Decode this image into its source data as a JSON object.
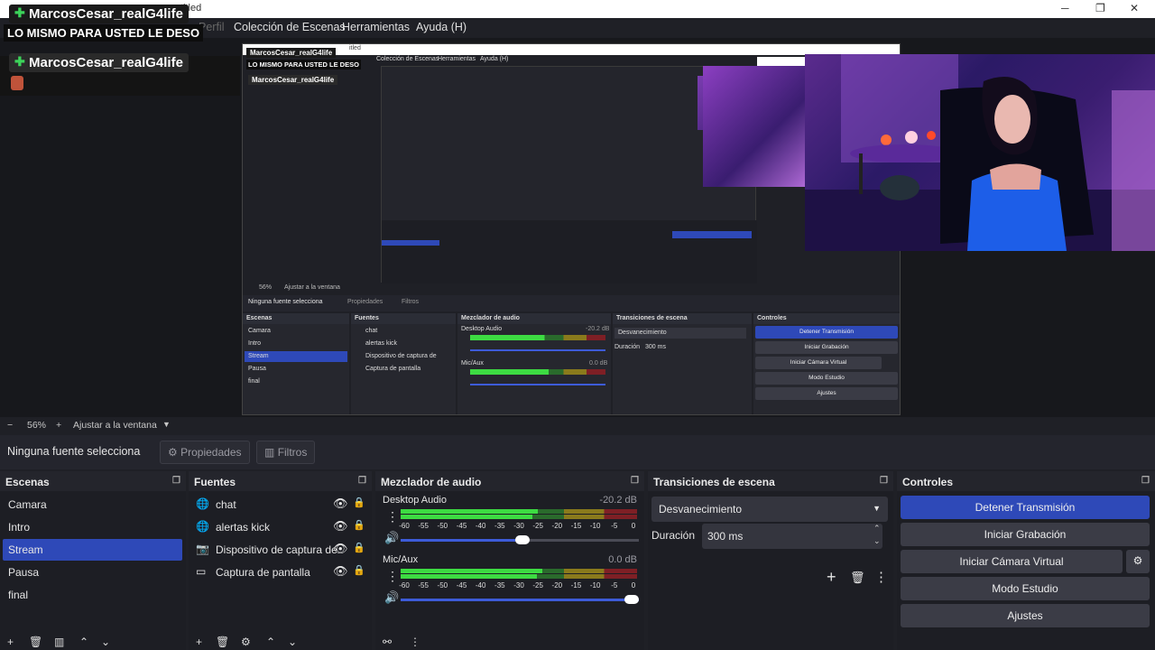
{
  "window": {
    "title_fragment": "titled",
    "min": "─",
    "max": "❐",
    "close": "✕"
  },
  "overlay": {
    "user_top": "MarcosCesar_realG4life",
    "banner": "LO MISMO PARA USTED LE DESO",
    "user_chat": "MarcosCesar_realG4life"
  },
  "menu": {
    "perfil": "Perfil",
    "colecciones": "Colección de Escenas",
    "herramientas": "Herramientas",
    "ayuda": "Ayuda (H)"
  },
  "zoom": {
    "minus": "−",
    "level": "56%",
    "plus": "+",
    "fit": "Ajustar a la ventana"
  },
  "source_bar": {
    "no_selection": "Ninguna fuente selecciona",
    "properties": "Propiedades",
    "filters": "Filtros"
  },
  "scenes": {
    "title": "Escenas",
    "items": [
      {
        "label": "Camara"
      },
      {
        "label": "Intro"
      },
      {
        "label": "Stream"
      },
      {
        "label": "Pausa"
      },
      {
        "label": "final"
      }
    ],
    "selected": 2
  },
  "sources": {
    "title": "Fuentes",
    "items": [
      {
        "label": "chat",
        "icon": "globe-icon"
      },
      {
        "label": "alertas kick",
        "icon": "globe-icon"
      },
      {
        "label": "Dispositivo de captura de",
        "icon": "camera-icon"
      },
      {
        "label": "Captura de pantalla",
        "icon": "monitor-icon"
      }
    ]
  },
  "mixer": {
    "title": "Mezclador de audio",
    "ticks": [
      "-60",
      "-55",
      "-50",
      "-45",
      "-40",
      "-35",
      "-30",
      "-25",
      "-20",
      "-15",
      "-10",
      "-5",
      "0"
    ],
    "channels": [
      {
        "name": "Desktop Audio",
        "db": "-20.2 dB",
        "level": 0.58,
        "volume": 0.48
      },
      {
        "name": "Mic/Aux",
        "db": "0.0 dB",
        "level": 0.6,
        "volume": 1.0
      }
    ]
  },
  "transitions": {
    "title": "Transiciones de escena",
    "selected": "Desvanecimiento",
    "duration_label": "Duración",
    "duration_value": "300 ms"
  },
  "controls": {
    "title": "Controles",
    "stop_stream": "Detener Transmisión",
    "start_recording": "Iniciar Grabación",
    "start_virtual_cam": "Iniciar Cámara Virtual",
    "studio_mode": "Modo Estudio",
    "settings": "Ajustes"
  },
  "nested": {
    "title_fragment": "itled",
    "menu": [
      "Colección de Escenas",
      "Herramientas",
      "Ayuda (H)"
    ],
    "zoom": "56%",
    "fit": "Ajustar a la ventana",
    "no_selection": "Ninguna fuente selecciona",
    "props": "Propiedades",
    "filters": "Filtros",
    "docks": [
      "Escenas",
      "Fuentes",
      "Mezclador de audio",
      "Transiciones de escena",
      "Controles"
    ],
    "scenes": [
      "Camara",
      "Intro",
      "Stream",
      "Pausa",
      "final"
    ],
    "sources": [
      "chat",
      "alertas kick",
      "Dispositivo de captura de",
      "Captura de pantalla"
    ],
    "desktop": "Desktop Audio",
    "desktop_db": "-20.2 dB",
    "mic": "Mic/Aux",
    "mic_db": "0.0 dB",
    "transition": "Desvanecimiento",
    "duration_label": "Duración",
    "duration": "300 ms",
    "controls": [
      "Detener Transmisión",
      "Iniciar Grabación",
      "Iniciar Cámara Virtual",
      "Modo Estudio",
      "Ajustes"
    ]
  }
}
